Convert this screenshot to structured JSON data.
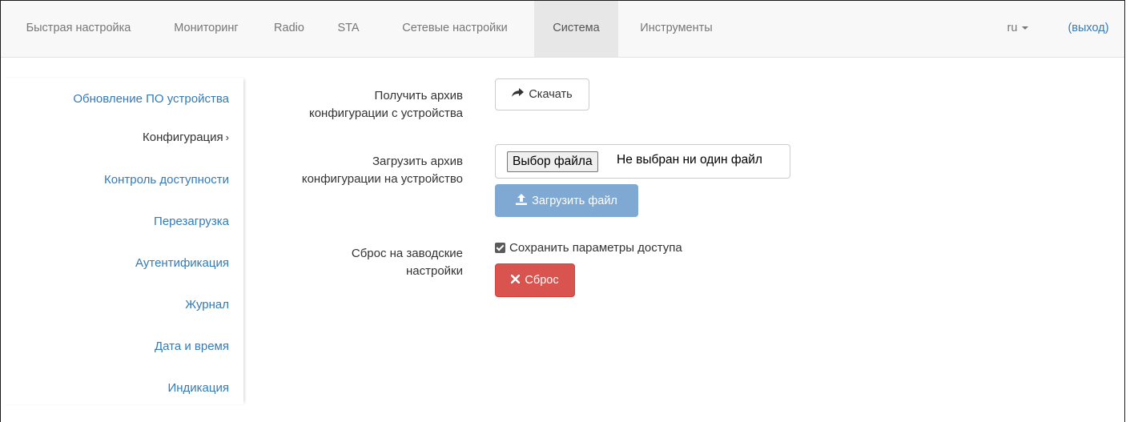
{
  "nav": {
    "items": [
      {
        "label": "Быстрая настройка"
      },
      {
        "label": "Мониторинг"
      },
      {
        "label": "Radio"
      },
      {
        "label": "STA"
      },
      {
        "label": "Сетевые настройки"
      },
      {
        "label": "Система",
        "active": true
      },
      {
        "label": "Инструменты"
      }
    ],
    "lang": "ru",
    "logout": "(выход)"
  },
  "sidebar": {
    "items": [
      {
        "label": "Обновление ПО устройства"
      },
      {
        "label": "Конфигурация",
        "current": true,
        "suffix": "›"
      },
      {
        "label": "Контроль доступности"
      },
      {
        "label": "Перезагрузка"
      },
      {
        "label": "Аутентификация"
      },
      {
        "label": "Журнал"
      },
      {
        "label": "Дата и время"
      },
      {
        "label": "Индикация"
      }
    ]
  },
  "config": {
    "download": {
      "label_line1": "Получить архив",
      "label_line2": "конфигурации с устройства",
      "button": "Скачать",
      "icon": "share-arrow-icon"
    },
    "upload": {
      "label_line1": "Загрузить архив",
      "label_line2": "конфигурации на устройство",
      "choose_button": "Выбор файла",
      "file_status": "Не выбран ни один файл",
      "upload_button": "Загрузить файл",
      "icon": "upload-icon"
    },
    "reset": {
      "label_line1": "Сброс на заводские",
      "label_line2": "настройки",
      "checkbox_label": "Сохранить параметры доступа",
      "checkbox_checked": true,
      "button": "Сброс",
      "icon": "close-x-icon"
    }
  },
  "colors": {
    "link": "#337ab7",
    "danger": "#d9534f",
    "primary_disabled": "#7fa8d3",
    "nav_bg": "#f8f8f8",
    "nav_active_bg": "#e7e7e7"
  }
}
